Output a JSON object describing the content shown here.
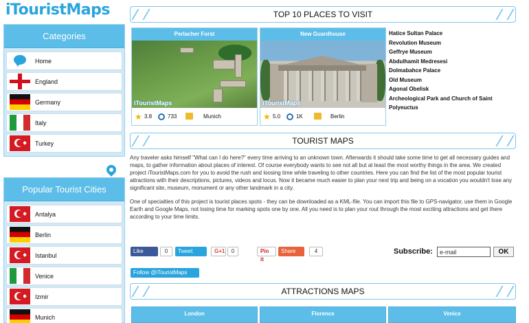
{
  "site": {
    "logo": "iTouristMaps"
  },
  "sidebar": {
    "categories_title": "Categories",
    "categories": [
      {
        "label": "Home",
        "icon": "speech-bubble-icon"
      },
      {
        "label": "England",
        "icon": "england-flag-icon"
      },
      {
        "label": "Germany",
        "icon": "germany-flag-icon"
      },
      {
        "label": "Italy",
        "icon": "italy-flag-icon"
      },
      {
        "label": "Turkey",
        "icon": "turkey-flag-icon"
      }
    ],
    "cities_title": "Popular Tourist Cities",
    "cities": [
      {
        "label": "Antalya",
        "icon": "turkey-flag-icon"
      },
      {
        "label": "Berlin",
        "icon": "germany-flag-icon"
      },
      {
        "label": "Istanbul",
        "icon": "turkey-flag-icon"
      },
      {
        "label": "Venice",
        "icon": "italy-flag-icon"
      },
      {
        "label": "Izmir",
        "icon": "turkey-flag-icon"
      },
      {
        "label": "Munich",
        "icon": "germany-flag-icon"
      }
    ]
  },
  "top10": {
    "title": "TOP 10 PLACES TO VISIT",
    "cards": [
      {
        "title": "Perlacher Forst",
        "watermark": "iTouristMaps",
        "rating": "3.8",
        "views": "733",
        "city": "Munich"
      },
      {
        "title": "New Guardhouse",
        "watermark": "iTouristMaps",
        "rating": "5.0",
        "views": "1K",
        "city": "Berlin"
      }
    ],
    "list": [
      "Hatice Sultan Palace",
      "Revolution Museum",
      "Geffrye Museum",
      "Abdulhamit Medresesi",
      "Dolmabahce Palace",
      "Old Museum",
      "Agonal Obelisk",
      "Archeological Park and Church of Saint Polyeuctus"
    ]
  },
  "tourist_maps": {
    "title": "TOURIST MAPS",
    "paragraphs": [
      "Any traveler asks himself \"What can I do here?\" every time arriving to an unknown town. Afterwards it should take some time to get all necessary guides and maps, to gather information about places of interest. Of course everybody wants to see not all but at least the most worthy things in the area. We created project iTouristMaps.com for you to avoid the rush and loosing time while traveling to other countries. Here you can find the list of the most popular tourist attractions with their descriptions, pictures, videos and locus. Now it became much easier to plan your next trip and being on a vocation you wouldn't lose any significant site, museum, monument or any other landmark in a city.",
      "One of specialties of this project is tourist places spots - they can be downloaded as a KML-file. You can import this file to GPS-navigator, use them in Google Earth and Google Maps, not losing time for marking spots one by one. All you need is to plan your rout through the most exciting attractions and get there according to your time limits."
    ]
  },
  "social": {
    "fb_like": "Like",
    "fb_count": "0",
    "tweet": "Tweet",
    "tweet_count": "0",
    "gplus": "G+1",
    "gplus_count": "0",
    "pinit": "Pin it",
    "share": "Share",
    "share_count": "4",
    "follow": "Follow @iTouristMaps"
  },
  "subscribe": {
    "label": "Subscribe:",
    "value": "e-mail",
    "button": "OK"
  },
  "attractions": {
    "title": "ATTRACTIONS MAPS",
    "tabs": [
      "London",
      "Florence",
      "Venice"
    ]
  },
  "colors": {
    "accent": "#2aa4dd",
    "panel": "#cfe9f6",
    "header": "#5bbde8"
  }
}
